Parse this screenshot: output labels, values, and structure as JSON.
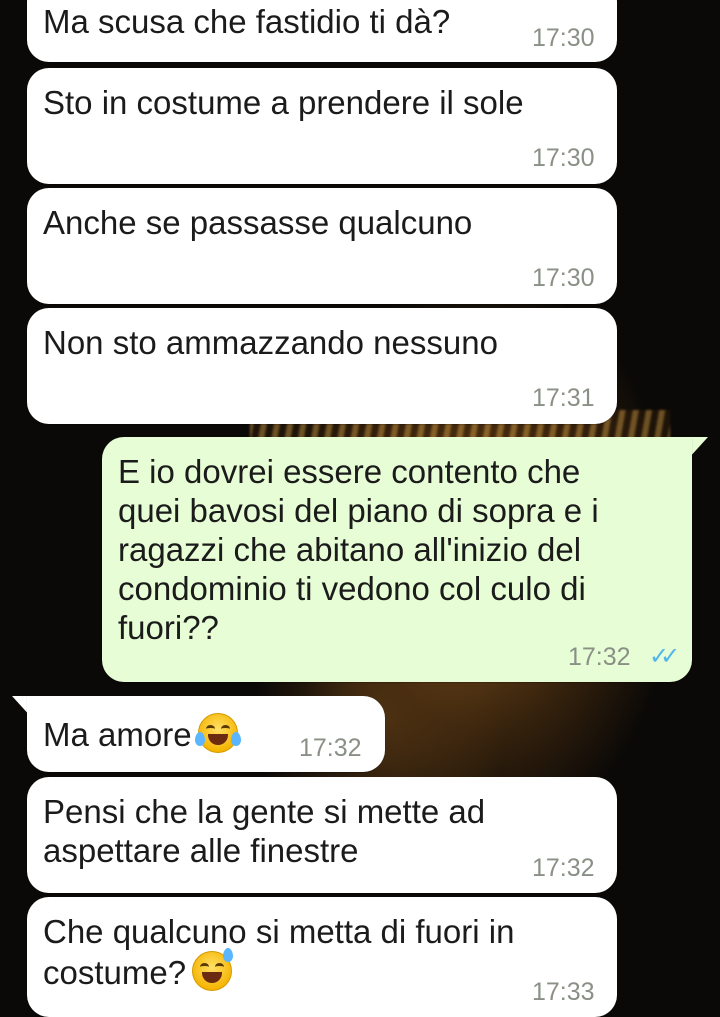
{
  "messages": [
    {
      "direction": "incoming",
      "text": "Ma scusa che fastidio ti dà?",
      "time": "17:30"
    },
    {
      "direction": "incoming",
      "text": "Sto in costume a prendere il sole",
      "time": "17:30"
    },
    {
      "direction": "incoming",
      "text": "Anche se passasse qualcuno",
      "time": "17:30"
    },
    {
      "direction": "incoming",
      "text": "Non sto ammazzando nessuno",
      "time": "17:31"
    },
    {
      "direction": "outgoing",
      "text": "E io dovrei essere contento che\nquei bavosi del piano di sopra e i\nragazzi che abitano all'inizio del\ncondominio ti vedono col culo di\nfuori??",
      "time": "17:32",
      "status": "read"
    },
    {
      "direction": "incoming",
      "text": "Ma amore",
      "emoji": "face-with-tears-of-joy-emoji",
      "time": "17:32"
    },
    {
      "direction": "incoming",
      "text": "Pensi che la gente si mette ad\naspettare alle finestre",
      "time": "17:32"
    },
    {
      "direction": "incoming",
      "text": "Che qualcuno si metta di fuori in\ncostume?",
      "emoji": "grinning-face-with-sweat-emoji",
      "time": "17:33"
    }
  ],
  "read_receipt": "✓✓",
  "colors": {
    "incoming_bubble": "#ffffff",
    "outgoing_bubble": "#e7fdd5",
    "read_tick": "#4fb6ec",
    "timestamp": "#8a9086"
  },
  "wallpaper": "lion-photo-dark"
}
